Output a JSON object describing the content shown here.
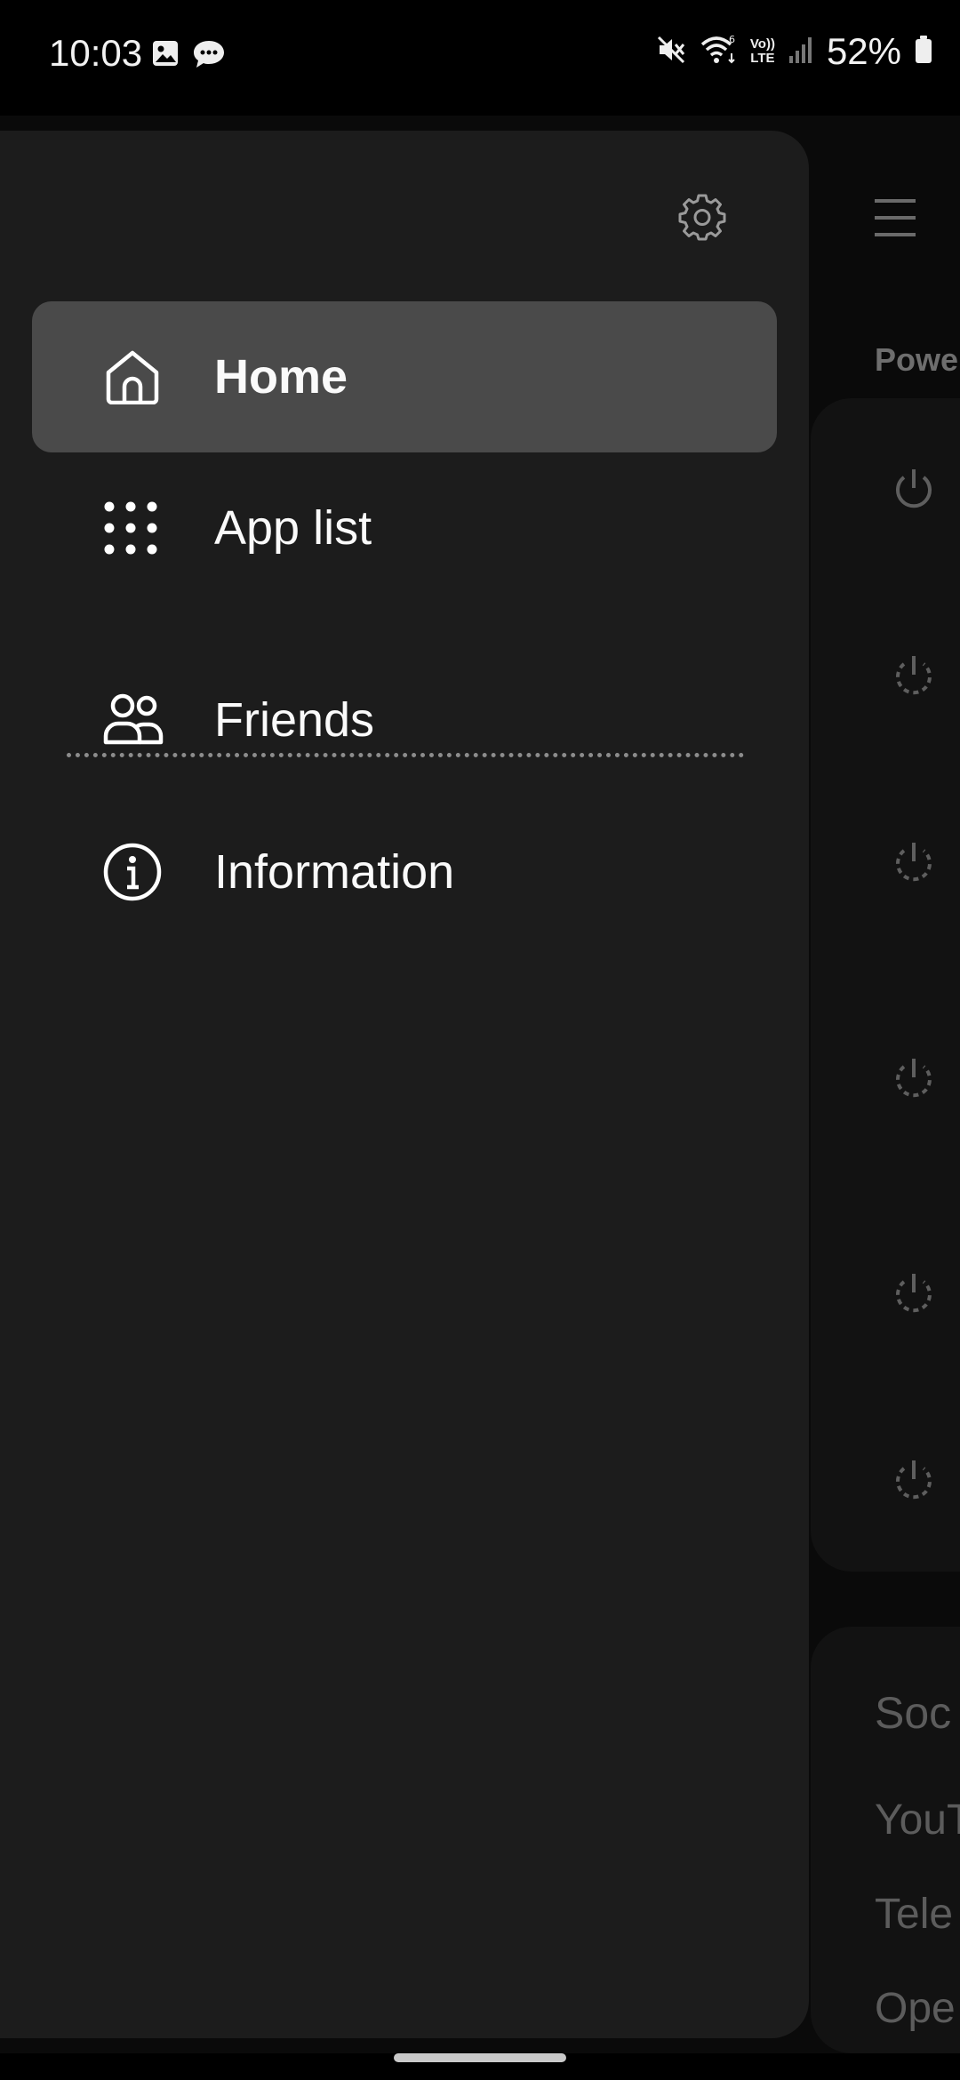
{
  "status_bar": {
    "time": "10:03",
    "battery_percent": "52%",
    "network": "LTE",
    "icons": [
      "gallery-icon",
      "message-icon",
      "mute-icon",
      "wifi-icon",
      "volte-icon",
      "signal-icon",
      "battery-icon"
    ]
  },
  "drawer": {
    "settings_icon": "gear-icon",
    "items": [
      {
        "label": "Home",
        "icon": "home-icon",
        "selected": true
      },
      {
        "label": "App list",
        "icon": "grid-icon",
        "selected": false
      },
      {
        "label": "Friends",
        "icon": "people-icon",
        "selected": false
      },
      {
        "label": "Information",
        "icon": "info-icon",
        "selected": false
      }
    ]
  },
  "background": {
    "section_label": "Powe",
    "social_title": "Soc",
    "social_items": [
      "YouT",
      "Tele",
      "Ope"
    ]
  },
  "colors": {
    "drawer_bg": "#1c1c1c",
    "selected_bg": "#4a4a4a",
    "screen_bg": "#000000"
  }
}
